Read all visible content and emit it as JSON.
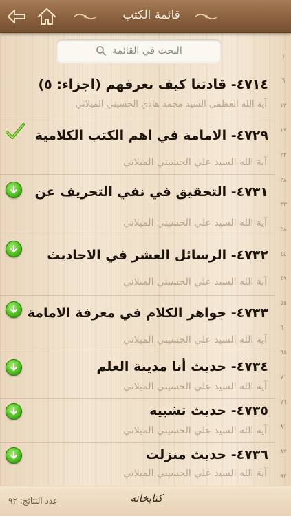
{
  "header": {
    "title": "قائمة الكتب",
    "back_icon": "back-arrow-icon",
    "home_icon": "home-icon"
  },
  "search": {
    "placeholder": "البحث في القائمة",
    "icon": "search-icon"
  },
  "books": [
    {
      "title": "٤٧١٤- قادتنا كيف نعرفهم (اجزاء: ٥)",
      "author": "آية الله العظمى السيد محمد هادي الحسيني الميلاني",
      "status": "none"
    },
    {
      "title": "٤٧٢٩- الامامة في اهم الكتب الكلامية",
      "author": "آية الله السيد علي الحسيني الميلاني",
      "status": "downloaded"
    },
    {
      "title": "٤٧٣١- التحقيق في نفي التحريف عن",
      "author": "آية الله السيد علي الحسيني الميلاني",
      "status": "download"
    },
    {
      "title": "٤٧٣٢- الرسائل العشر في الاحاديث",
      "author": "آية الله السيد علي الحسيني الميلاني",
      "status": "download"
    },
    {
      "title": "٤٧٣٣- جواهر الكلام في معرفة الامامة",
      "author": "آية الله السيد علي الحسيني الميلاني",
      "status": "download"
    },
    {
      "title": "٤٧٣٤- حديث أنا مدينة العلم",
      "author": "آية الله السيد علي الحسيني الميلاني",
      "status": "download"
    },
    {
      "title": "٤٧٣٥- حديث تشبيه",
      "author": "آية الله السيد علي الحسيني الميلاني",
      "status": "download"
    },
    {
      "title": "٤٧٣٦- حديث منزلت",
      "author": "آية الله السيد علي الحسيني الميلاني",
      "status": "download"
    }
  ],
  "index": [
    "١",
    "٦",
    "١٢",
    "١٧",
    "٢٢",
    "٢٨",
    "٣٣",
    "٣٨",
    "٤٤",
    "٤٩",
    "٥٥",
    "٦٠",
    "٦٥",
    "٧١",
    "٧٦",
    "٨١",
    "٨٧",
    "٩٢"
  ],
  "footer": {
    "count": "عدد النتائج: ٩٢",
    "logo": "كتابخانه"
  },
  "colors": {
    "accent_green": "#4fc21d",
    "header_brown": "#8b623f"
  }
}
